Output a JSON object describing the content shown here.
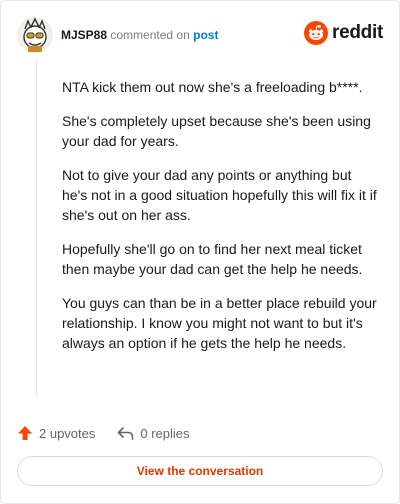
{
  "header": {
    "username": "MJSP88",
    "action_text": "commented on",
    "post_link": "post",
    "logo_text": "reddit",
    "logo_icon": "reddit-snoo-icon",
    "avatar_icon": "user-avatar"
  },
  "comment": {
    "paragraphs": [
      "NTA kick them out now she's a freeloading b****.",
      "She's completely upset because she's been using your dad for years.",
      "Not to give your dad any points or anything but he's not in a good situation hopefully this will fix it if she's out on her ass.",
      "Hopefully she'll go on to find her next meal ticket then maybe your dad can get the help he needs.",
      "You guys can than be in a better place rebuild your relationship. I know you might not want to but it's always an option if he gets the help he needs."
    ]
  },
  "actions": {
    "upvotes": "2 upvotes",
    "replies": "0 replies"
  },
  "cta": {
    "label": "View the conversation"
  },
  "colors": {
    "brand": "#ff4500",
    "link": "#0079d3",
    "cta_text": "#d93a00",
    "upvote": "#ff4500"
  }
}
